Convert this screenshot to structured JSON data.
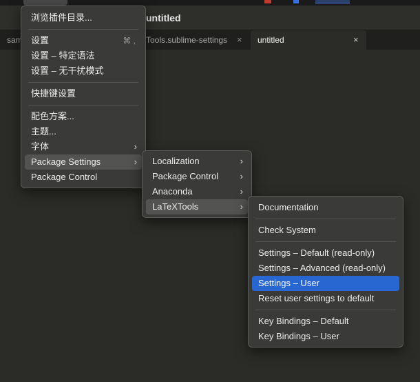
{
  "window": {
    "title": "untitled"
  },
  "tabs": [
    {
      "label": "sam"
    },
    {
      "label": "Tools.sublime-settings"
    },
    {
      "label": "untitled",
      "active": true
    }
  ],
  "tab_close_glyph": "×",
  "main_menu": {
    "browse_packages": "浏览插件目录...",
    "settings": "设置",
    "settings_shortcut": "⌘ ,",
    "syntax_settings": "设置 – 特定语法",
    "distraction_free": "设置 – 无干扰模式",
    "key_bindings": "快捷键设置",
    "color_scheme": "配色方案...",
    "theme": "主题...",
    "font": "字体",
    "package_settings": "Package Settings",
    "package_control": "Package Control"
  },
  "package_menu": {
    "localization": "Localization",
    "package_control": "Package Control",
    "anaconda": "Anaconda",
    "latextools": "LaTeXTools"
  },
  "latex_menu": {
    "documentation": "Documentation",
    "check_system": "Check System",
    "settings_default": "Settings – Default (read-only)",
    "settings_advanced": "Settings – Advanced (read-only)",
    "settings_user": "Settings – User",
    "reset_settings": "Reset user settings to default",
    "key_bindings_default": "Key Bindings – Default",
    "key_bindings_user": "Key Bindings – User"
  },
  "submenu_arrow": "›",
  "colors": {
    "selection": "#2866d1",
    "menu_bg": "#3a3a38",
    "editor_bg": "#2b2b27"
  }
}
